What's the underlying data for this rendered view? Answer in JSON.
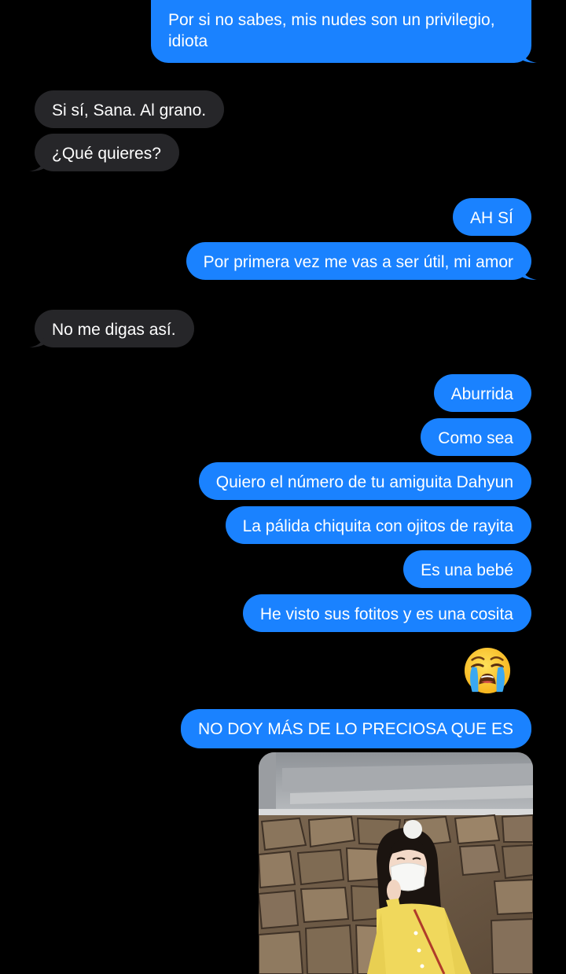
{
  "conversation": {
    "messages": [
      {
        "side": "out",
        "text": "Por si no sabes, mis nudes son un privilegio, idiota"
      },
      {
        "side": "in",
        "text": "Si sí, Sana. Al grano."
      },
      {
        "side": "in",
        "text": "¿Qué quieres?"
      },
      {
        "side": "out",
        "text": "AH SÍ"
      },
      {
        "side": "out",
        "text": "Por primera vez me vas a ser útil, mi amor"
      },
      {
        "side": "in",
        "text": "No me digas así."
      },
      {
        "side": "out",
        "text": "Aburrida"
      },
      {
        "side": "out",
        "text": "Como sea"
      },
      {
        "side": "out",
        "text": "Quiero el número de tu amiguita Dahyun"
      },
      {
        "side": "out",
        "text": "La pálida chiquita con ojitos de rayita"
      },
      {
        "side": "out",
        "text": "Es una bebé"
      },
      {
        "side": "out",
        "text": "He visto sus fotitos y es una cosita"
      },
      {
        "side": "out",
        "emoji": "loudly-crying-face"
      },
      {
        "side": "out",
        "text": "NO DOY MÁS DE LO PRECIOSA QUE ES"
      },
      {
        "side": "out",
        "image": "photo-attachment"
      }
    ]
  },
  "colors": {
    "background": "#000000",
    "outgoing_bubble": "#1a82ff",
    "incoming_bubble": "#262629",
    "text": "#ffffff"
  }
}
